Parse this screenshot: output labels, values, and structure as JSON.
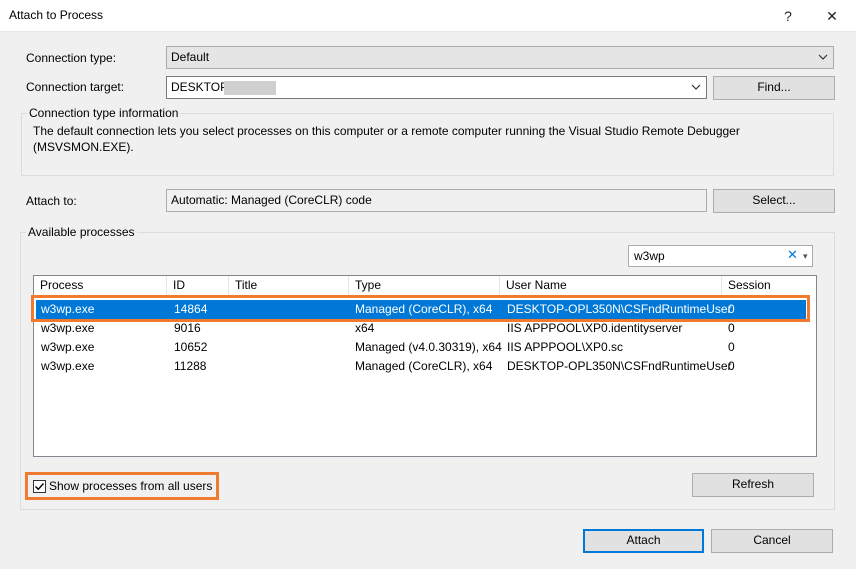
{
  "window": {
    "title": "Attach to Process",
    "help_glyph": "?",
    "close_glyph": "✕"
  },
  "connection_type": {
    "label": "Connection type:",
    "value": "Default"
  },
  "connection_target": {
    "label": "Connection target:",
    "value_prefix": "DESKTOP-"
  },
  "find_button": {
    "label": "Find..."
  },
  "connection_info": {
    "group_title": "Connection type information",
    "description": "The default connection lets you select processes on this computer or a remote computer running the Visual Studio Remote Debugger (MSVSMON.EXE)."
  },
  "attach_to": {
    "label": "Attach to:",
    "value": "Automatic: Managed (CoreCLR) code"
  },
  "select_button": {
    "label": "Select..."
  },
  "available_processes": {
    "group_title": "Available processes",
    "filter_value": "w3wp",
    "columns": [
      "Process",
      "ID",
      "Title",
      "Type",
      "User Name",
      "Session"
    ],
    "rows": [
      [
        "w3wp.exe",
        "14864",
        "",
        "Managed (CoreCLR), x64",
        "DESKTOP-OPL350N\\CSFndRuntimeUser",
        "0"
      ],
      [
        "w3wp.exe",
        "9016",
        "",
        "x64",
        "IIS APPPOOL\\XP0.identityserver",
        "0"
      ],
      [
        "w3wp.exe",
        "10652",
        "",
        "Managed (v4.0.30319), x64",
        "IIS APPPOOL\\XP0.sc",
        "0"
      ],
      [
        "w3wp.exe",
        "11288",
        "",
        "Managed (CoreCLR), x64",
        "DESKTOP-OPL350N\\CSFndRuntimeUser",
        "0"
      ]
    ],
    "selected_row": 0
  },
  "show_all_users": {
    "label": "Show processes from all users",
    "checked": true
  },
  "refresh_button": {
    "label": "Refresh"
  },
  "attach_button": {
    "label": "Attach"
  },
  "cancel_button": {
    "label": "Cancel"
  },
  "colors": {
    "selection": "#0078d7",
    "highlight_frame": "#f07b2e",
    "clear_icon": "#0078d7"
  },
  "icons": [
    "help-icon",
    "close-icon",
    "chevron-down-icon",
    "clear-filter-icon",
    "checkmark-icon"
  ]
}
